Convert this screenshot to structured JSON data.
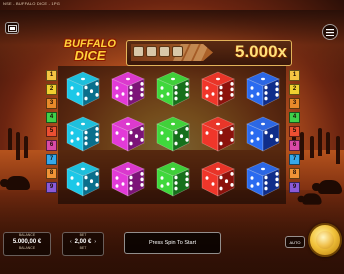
{
  "app": {
    "title": "NSE - BUFFALO DICE - 1PG"
  },
  "header": {
    "menu_icon": "hamburger-menu-icon",
    "screen_icon": "screen-toggle-icon"
  },
  "game": {
    "logo_line1": "BUFFALO",
    "logo_line2": "DICE",
    "max_multiplier": "5.000x"
  },
  "paylines": {
    "left": [
      "1",
      "2",
      "3",
      "4",
      "5",
      "6",
      "7",
      "8",
      "9"
    ],
    "right": [
      "1",
      "2",
      "3",
      "4",
      "5",
      "6",
      "7",
      "8",
      "9"
    ],
    "colors": [
      "#f4c542",
      "#f0d030",
      "#e88a2a",
      "#3fd14a",
      "#ec4f32",
      "#d94aa8",
      "#36a8ea",
      "#f09436",
      "#8a5ad8"
    ]
  },
  "reels": {
    "columns": [
      {
        "color": "#1cc8e8",
        "dark": "#0a6f8c",
        "values": [
          5,
          6,
          5
        ]
      },
      {
        "color": "#e23ad8",
        "dark": "#7c1478",
        "values": [
          6,
          5,
          6
        ]
      },
      {
        "color": "#3fd83c",
        "dark": "#17701c",
        "values": [
          6,
          5,
          6
        ]
      },
      {
        "color": "#f0362a",
        "dark": "#8c120c",
        "values": [
          6,
          4,
          5
        ]
      },
      {
        "color": "#2a6bf0",
        "dark": "#102e8a",
        "values": [
          6,
          3,
          6
        ]
      }
    ]
  },
  "panel": {
    "balance_label": "BALANCE",
    "balance_value": "5.000,00 €",
    "balance_sub": "BALANCE",
    "bet_label": "BET",
    "bet_value": "2,00 €",
    "bet_sub": "BET",
    "message": "Press Spin To Start",
    "auto_label": "AUTO",
    "spin_icon": "spin-button-icon"
  }
}
